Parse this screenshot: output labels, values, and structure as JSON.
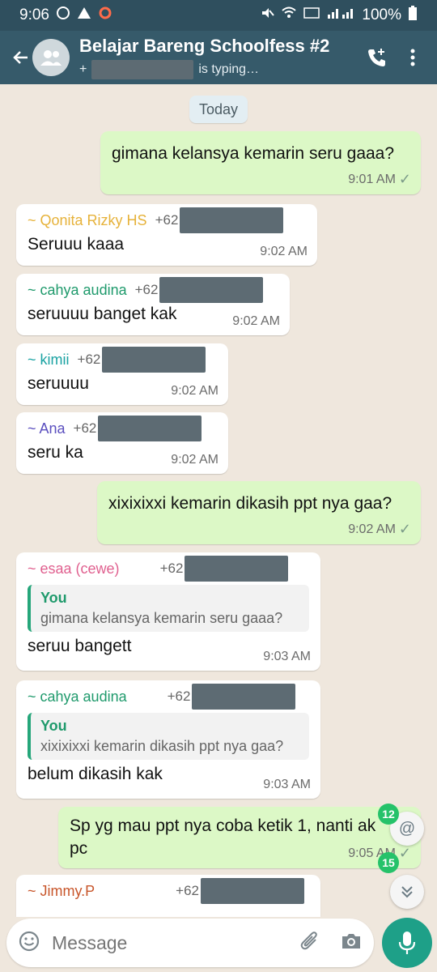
{
  "status": {
    "time": "9:06",
    "battery": "100%"
  },
  "header": {
    "title": "Belajar Bareng Schoolfess #2",
    "typing_prefix": "+",
    "typing_suffix": "is typing…"
  },
  "date_label": "Today",
  "messages": [
    {
      "text": "gimana kelansya kemarin seru gaaa?",
      "time": "9:01 AM"
    },
    {
      "sender": "~ Qonita Rizky HS",
      "phone": "+62",
      "text": "Seruuu kaaa",
      "time": "9:02 AM"
    },
    {
      "sender": "~ cahya audina",
      "phone": "+62",
      "text": "seruuuu banget kak",
      "time": "9:02 AM"
    },
    {
      "sender": "~ kimii",
      "phone": "+62",
      "text": "seruuuu",
      "time": "9:02 AM"
    },
    {
      "sender": "~ Ana",
      "phone": "+62",
      "text": "seru ka",
      "time": "9:02 AM"
    },
    {
      "text": "xixixixxi kemarin dikasih ppt nya gaa?",
      "time": "9:02 AM"
    },
    {
      "sender": "~ esaa (cewe)",
      "phone": "+62",
      "quote_name": "You",
      "quote_text": "gimana kelansya kemarin seru gaaa?",
      "text": "seruu bangett",
      "time": "9:03 AM"
    },
    {
      "sender": "~ cahya audina",
      "phone": "+62",
      "quote_name": "You",
      "quote_text": "xixixixxi kemarin dikasih ppt nya gaa?",
      "text": "belum dikasih kak",
      "time": "9:03 AM"
    },
    {
      "text_line1": "Sp yg mau ppt nya coba ketik 1, nanti ak",
      "text_line2": "pc",
      "time": "9:05 AM"
    },
    {
      "sender": "~ Jimmy.P",
      "phone": "+62"
    }
  ],
  "badges": {
    "mentions": "12",
    "unread": "15",
    "mention_symbol": "@"
  },
  "input": {
    "placeholder": "Message"
  },
  "colors": {
    "header": "#365a6a",
    "out_bubble": "#dcf8c6",
    "accent": "#1ea088"
  }
}
